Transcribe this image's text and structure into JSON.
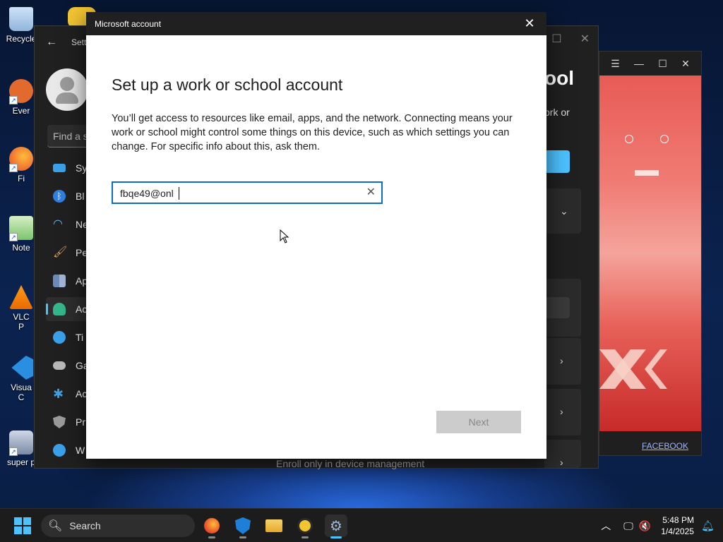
{
  "desktop": {
    "icons": [
      {
        "label": "Recycle"
      },
      {
        "label": "Ever"
      },
      {
        "label": "Fi"
      },
      {
        "label": "Note"
      },
      {
        "label": "VLC"
      },
      {
        "label": "P"
      },
      {
        "label": "Visua"
      },
      {
        "label": "C"
      },
      {
        "label": "super p"
      }
    ]
  },
  "settings": {
    "title": "Setti",
    "find_placeholder": "Find a s",
    "nav": [
      {
        "label": "Sy",
        "icon": "system-icon",
        "color": "#3aa0e8"
      },
      {
        "label": "Bl",
        "icon": "bluetooth-icon",
        "color": "#2f7fe0"
      },
      {
        "label": "Ne",
        "icon": "wifi-icon",
        "color": "#5fb8f0"
      },
      {
        "label": "Pe",
        "icon": "brush-icon",
        "color": "#e0a060"
      },
      {
        "label": "Ap",
        "icon": "apps-icon",
        "color": "#6d8bb8"
      },
      {
        "label": "Ac",
        "icon": "accounts-icon",
        "color": "#34b58a"
      },
      {
        "label": "Ti",
        "icon": "time-icon",
        "color": "#3aa0e8"
      },
      {
        "label": "Ga",
        "icon": "gaming-icon",
        "color": "#b8b8b8"
      },
      {
        "label": "Ac",
        "icon": "accessibility-icon",
        "color": "#3aa0e8"
      },
      {
        "label": "Pr",
        "icon": "privacy-shield-icon",
        "color": "#9a9a9a"
      },
      {
        "label": "W",
        "icon": "update-icon",
        "color": "#3aa0e8"
      }
    ],
    "peek_title": "ool",
    "peek_desc_1": "ork or",
    "peek_desc_2": "·",
    "enroll_text": "Enroll only in device management"
  },
  "game": {
    "facebook_label": "FACEBOOK"
  },
  "dialog": {
    "title": "Microsoft account",
    "heading": "Set up a work or school account",
    "body": "You’ll get access to resources like email, apps, and the network. Connecting means your work or school might control some things on this device, such as which settings you can change. For specific info about this, ask them.",
    "email_value": "fbqe49@onl",
    "next_label": "Next"
  },
  "taskbar": {
    "search_label": "Search",
    "time": "5:48 PM",
    "date": "1/4/2025"
  }
}
